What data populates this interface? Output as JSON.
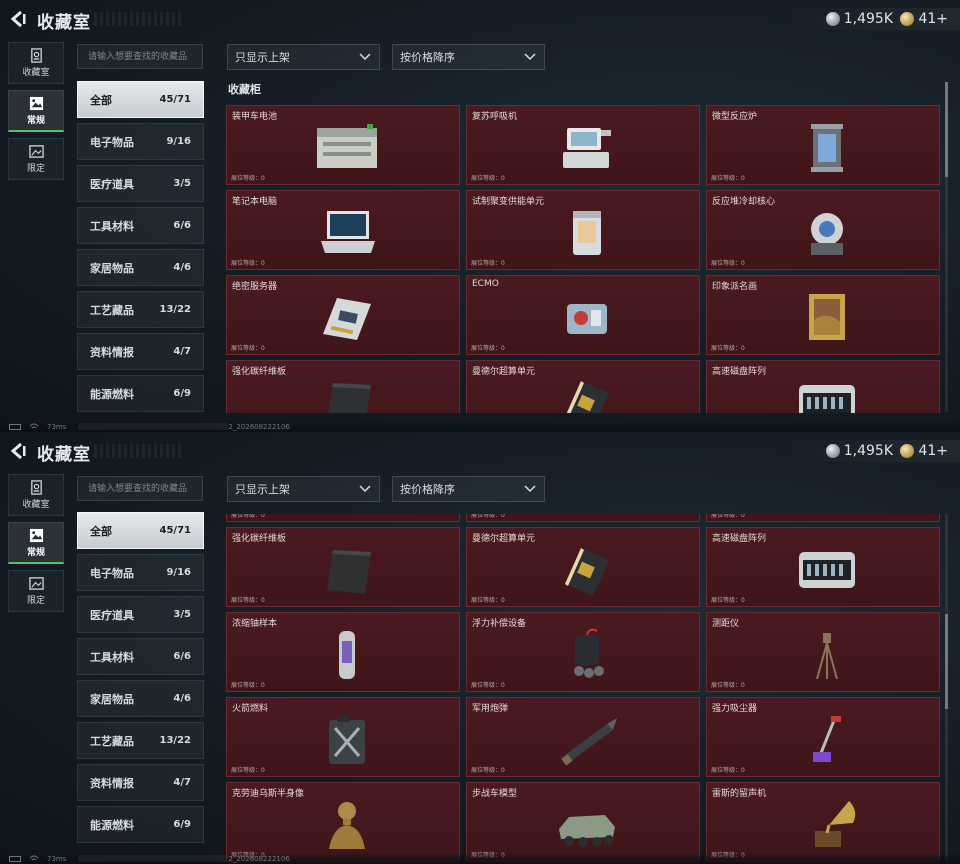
{
  "header": {
    "title": "收藏室",
    "currency_silver": "1,495K",
    "currency_gold": "41+"
  },
  "side_nav": [
    {
      "label": "收藏室",
      "icon": "vault-door-icon",
      "active": false
    },
    {
      "label": "常规",
      "icon": "picture-icon",
      "active": true
    },
    {
      "label": "限定",
      "icon": "image-frame-icon",
      "active": false
    }
  ],
  "search": {
    "placeholder": "请输入想要查找的收藏品"
  },
  "filters": {
    "shelf": "只显示上架",
    "sort": "按价格降序"
  },
  "categories": [
    {
      "label": "全部",
      "count": "45/71",
      "active": true
    },
    {
      "label": "电子物品",
      "count": "9/16"
    },
    {
      "label": "医疗道具",
      "count": "3/5"
    },
    {
      "label": "工具材料",
      "count": "6/6"
    },
    {
      "label": "家居物品",
      "count": "4/6"
    },
    {
      "label": "工艺藏品",
      "count": "13/22"
    },
    {
      "label": "资料情报",
      "count": "4/7"
    },
    {
      "label": "能源燃料",
      "count": "6/9"
    }
  ],
  "cabinet_title": "收藏柜",
  "items": [
    {
      "name": "装甲车电池",
      "level_label": "展位等级：",
      "level": "0",
      "icon": "armored-battery-icon"
    },
    {
      "name": "复苏呼吸机",
      "level_label": "展位等级：",
      "level": "0",
      "icon": "ventilator-icon"
    },
    {
      "name": "微型反应炉",
      "level_label": "展位等级：",
      "level": "0",
      "icon": "micro-reactor-icon"
    },
    {
      "name": "笔记本电脑",
      "level_label": "展位等级：",
      "level": "0",
      "icon": "laptop-icon"
    },
    {
      "name": "试制聚变供能单元",
      "level_label": "展位等级：",
      "level": "0",
      "icon": "fusion-cell-icon"
    },
    {
      "name": "反应堆冷却核心",
      "level_label": "展位等级：",
      "level": "0",
      "icon": "cooling-core-icon"
    },
    {
      "name": "绝密服务器",
      "level_label": "展位等级：",
      "level": "0",
      "icon": "server-icon"
    },
    {
      "name": "ECMO",
      "level_label": "展位等级：",
      "level": "0",
      "icon": "ecmo-icon"
    },
    {
      "name": "印象派名画",
      "level_label": "展位等级：",
      "level": "0",
      "icon": "painting-icon"
    },
    {
      "name": "强化碳纤维板",
      "level_label": "展位等级：",
      "level": "0",
      "icon": "carbon-plate-icon"
    },
    {
      "name": "曼德尔超算单元",
      "level_label": "展位等级：",
      "level": "0",
      "icon": "supercomputer-icon"
    },
    {
      "name": "高速磁盘阵列",
      "level_label": "展位等级：",
      "level": "0",
      "icon": "disk-array-icon"
    },
    {
      "name": "浓缩铀样本",
      "level_label": "展位等级：",
      "level": "0",
      "icon": "uranium-icon"
    },
    {
      "name": "浮力补偿设备",
      "level_label": "展位等级：",
      "level": "0",
      "icon": "buoyancy-icon"
    },
    {
      "name": "测距仪",
      "level_label": "展位等级：",
      "level": "0",
      "icon": "rangefinder-icon"
    },
    {
      "name": "火箭燃料",
      "level_label": "展位等级：",
      "level": "0",
      "icon": "fuel-canister-icon"
    },
    {
      "name": "军用炮弹",
      "level_label": "展位等级：",
      "level": "0",
      "icon": "artillery-shell-icon"
    },
    {
      "name": "强力吸尘器",
      "level_label": "展位等级：",
      "level": "0",
      "icon": "vacuum-icon"
    },
    {
      "name": "克劳迪乌斯半身像",
      "level_label": "展位等级：",
      "level": "0",
      "icon": "bust-icon"
    },
    {
      "name": "步战车模型",
      "level_label": "展位等级：",
      "level": "0",
      "icon": "ifv-model-icon"
    },
    {
      "name": "雷斯的留声机",
      "level_label": "展位等级：",
      "level": "0",
      "icon": "gramophone-icon"
    }
  ],
  "status": {
    "latency": "73ms",
    "build_suffix": "2_202608222106"
  },
  "colors": {
    "card_bg": "#4a1a20",
    "card_border": "#6a2a31",
    "active_tab_accent": "#49c86f"
  }
}
